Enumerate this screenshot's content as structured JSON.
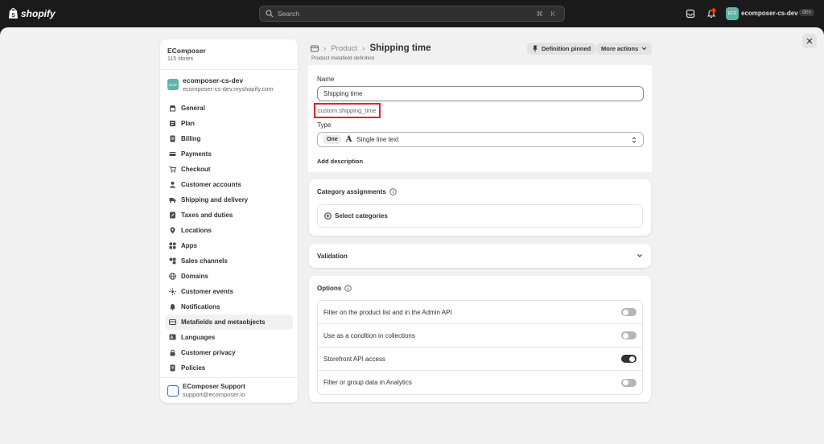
{
  "topbar": {
    "brand": "shopify",
    "search_placeholder": "Search",
    "search_shortcut": "⌘ K",
    "notification_count": "1",
    "store_avatar": "ECD",
    "store_name": "ecomposer-cs-dev",
    "store_tag": "dev"
  },
  "sidebar": {
    "org_name": "EComposer",
    "org_count": "115 stores",
    "store_avatar": "ECD",
    "store_title": "ecomposer-cs-dev",
    "store_url": "ecomposer-cs-dev.myshopify.com",
    "items": [
      {
        "label": "General",
        "icon": "store-icon"
      },
      {
        "label": "Plan",
        "icon": "plan-icon"
      },
      {
        "label": "Billing",
        "icon": "billing-icon"
      },
      {
        "label": "Payments",
        "icon": "payments-icon"
      },
      {
        "label": "Checkout",
        "icon": "cart-icon"
      },
      {
        "label": "Customer accounts",
        "icon": "person-icon"
      },
      {
        "label": "Shipping and delivery",
        "icon": "truck-icon"
      },
      {
        "label": "Taxes and duties",
        "icon": "tax-icon"
      },
      {
        "label": "Locations",
        "icon": "location-icon"
      },
      {
        "label": "Apps",
        "icon": "apps-icon"
      },
      {
        "label": "Sales channels",
        "icon": "channels-icon"
      },
      {
        "label": "Domains",
        "icon": "globe-icon"
      },
      {
        "label": "Customer events",
        "icon": "events-icon"
      },
      {
        "label": "Notifications",
        "icon": "bell-icon"
      },
      {
        "label": "Metafields and metaobjects",
        "icon": "metafields-icon"
      },
      {
        "label": "Languages",
        "icon": "languages-icon"
      },
      {
        "label": "Customer privacy",
        "icon": "lock-icon"
      },
      {
        "label": "Policies",
        "icon": "policy-icon"
      }
    ],
    "support_name": "EComposer Support",
    "support_email": "support@ecomposer.io"
  },
  "header": {
    "breadcrumb_parent": "Product",
    "title": "Shipping time",
    "subtitle": "Product metafield definition",
    "pinned_label": "Definition pinned",
    "more_actions_label": "More actions"
  },
  "definition": {
    "name_label": "Name",
    "name_value": "Shipping time",
    "namespace_key": "custom.shipping_time",
    "type_label": "Type",
    "type_tag": "One",
    "type_glyph": "A",
    "type_value": "Single line text",
    "add_description": "Add description"
  },
  "category": {
    "title": "Category assignments",
    "select_label": "Select categories"
  },
  "validation": {
    "title": "Validation"
  },
  "options": {
    "title": "Options",
    "items": [
      {
        "label": "Filter on the product list and in the Admin API",
        "on": false
      },
      {
        "label": "Use as a condition in collections",
        "on": false
      },
      {
        "label": "Storefront API access",
        "on": true
      },
      {
        "label": "Filter or group data in Analytics",
        "on": false
      }
    ]
  }
}
